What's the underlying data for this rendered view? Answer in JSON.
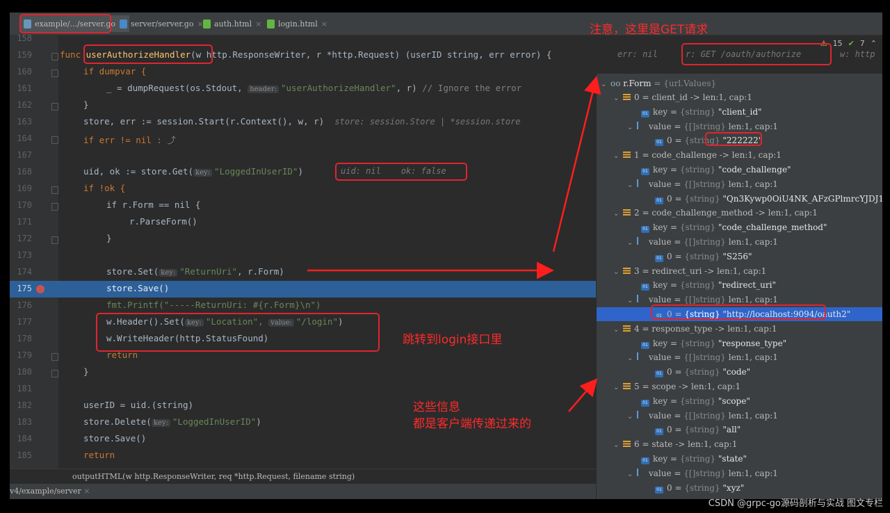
{
  "tabs": [
    {
      "label": "example/.../server.go",
      "color": "#6897bb"
    },
    {
      "label": "server/server.go",
      "color": "#4a88c7"
    },
    {
      "label": "auth.html",
      "color": "#62b543"
    },
    {
      "label": "login.html",
      "color": "#62b543"
    }
  ],
  "inspections": {
    "warnings": "15",
    "ok": "7"
  },
  "code": {
    "l158": "158",
    "l159": "159",
    "l160": "160",
    "l161": "161",
    "l162": "162",
    "l163": "163",
    "l164": "164",
    "l167": "167",
    "l168": "168",
    "l169": "169",
    "l170": "170",
    "l171": "171",
    "l172": "172",
    "l173": "173",
    "l174": "174",
    "l175": "175",
    "l176": "176",
    "l177": "177",
    "l178": "178",
    "l179": "179",
    "l180": "180",
    "l181": "181",
    "l182": "182",
    "l183": "183",
    "l184": "184",
    "l185": "185",
    "func_kw": "func",
    "func_name": "userAuthorizeHandler",
    "func_params": "(w http.ResponseWriter, r *http.Request) (userID string, err error) {",
    "hint_err": "err: nil",
    "hint_r": "r: GET /oauth/authorize",
    "hint_w": "w: http",
    "if_dumpvar": "if dumpvar {",
    "dump_call_a": "_ = dumpRequest(os.Stdout,",
    "pill_header": "header:",
    "dump_str": "\"userAuthorizeHandler\"",
    "dump_tail": ", r)",
    "dump_cmt": "// Ignore the error",
    "close_brace": "}",
    "store_line": "store, err := session.Start(r.Context(), w, r)",
    "store_hint": "store: session.Store | *session.store",
    "if_err": "if err != nil",
    "if_err_tail": ": ⤴",
    "uid_line_a": "uid, ok := store.Get(",
    "pill_key": "key:",
    "uid_str": "\"LoggedInUserID\"",
    "uid_tail": ")",
    "uid_hint": "uid: nil    ok: false",
    "if_ok": "if !ok {",
    "if_form": "if r.Form == nil {",
    "parse_form": "r.ParseForm()",
    "set_line_a": "store.Set(",
    "set_str": "\"ReturnUri\"",
    "set_tail": ", r.Form)",
    "save_line": "store.Save()",
    "printf_line": "fmt.Printf(\"-----ReturnUri: #{r.Form}\\n\")",
    "header_a": "w.Header().Set(",
    "loc_str": "\"Location\",",
    "pill_value": "value:",
    "login_str": "\"/login\"",
    "header_tail": ")",
    "write_header": "w.WriteHeader(http.StatusFound)",
    "return_kw": "return",
    "userid_line": "userID = uid.(string)",
    "delete_a": "store.Delete(",
    "delete_str": "\"LoggedInUserID\"",
    "delete_tail": ")",
    "save2": "store.Save()",
    "return2": "return"
  },
  "breadcrumb": "outputHTML(w http.ResponseWriter, req *http.Request, filename string)",
  "run_tab": "v4/example/server",
  "debugger": {
    "root": "r.Form",
    "root_type": "= {url.Values}",
    "rows": [
      {
        "label": "0 = client_id -> len:1, cap:1"
      },
      {
        "key": "\"client_id\""
      },
      {
        "value": "len:1, cap:1"
      },
      {
        "elem": "\"222222\""
      },
      {
        "label": "1 = code_challenge -> len:1, cap:1"
      },
      {
        "key": "\"code_challenge\""
      },
      {
        "value": "len:1, cap:1"
      },
      {
        "elem": "\"Qn3Kywp0OiU4NK_AFzGPlmrcYJDJ1..."
      },
      {
        "label": "2 = code_challenge_method -> len:1, cap:1"
      },
      {
        "key": "\"code_challenge_method\""
      },
      {
        "value": "len:1, cap:1"
      },
      {
        "elem": "\"S256\""
      },
      {
        "label": "3 = redirect_uri -> len:1, cap:1"
      },
      {
        "key": "\"redirect_uri\""
      },
      {
        "value": "len:1, cap:1"
      },
      {
        "elem": "\"http://localhost:9094/oauth2\""
      },
      {
        "label": "4 = response_type -> len:1, cap:1"
      },
      {
        "key": "\"response_type\""
      },
      {
        "value": "len:1, cap:1"
      },
      {
        "elem": "\"code\""
      },
      {
        "label": "5 = scope -> len:1, cap:1"
      },
      {
        "key": "\"scope\""
      },
      {
        "value": "len:1, cap:1"
      },
      {
        "elem": "\"all\""
      },
      {
        "label": "6 = state -> len:1, cap:1"
      },
      {
        "key": "\"state\""
      },
      {
        "value": "len:1, cap:1"
      },
      {
        "elem": "\"xyz\""
      }
    ],
    "key_prefix": "key",
    "value_prefix": "value",
    "string_type": "{string}",
    "slice_type": "{[]string}",
    "elem_prefix": "0 =",
    "fld_badge": "01"
  },
  "annotations": {
    "get_note": "注意，这里是GET请求",
    "login_note": "跳转到login接口里",
    "client_note_1": "这些信息",
    "client_note_2": "都是客户端传递过来的"
  },
  "watermark": "CSDN @grpc-go源码剖析与实战 图文专栏"
}
